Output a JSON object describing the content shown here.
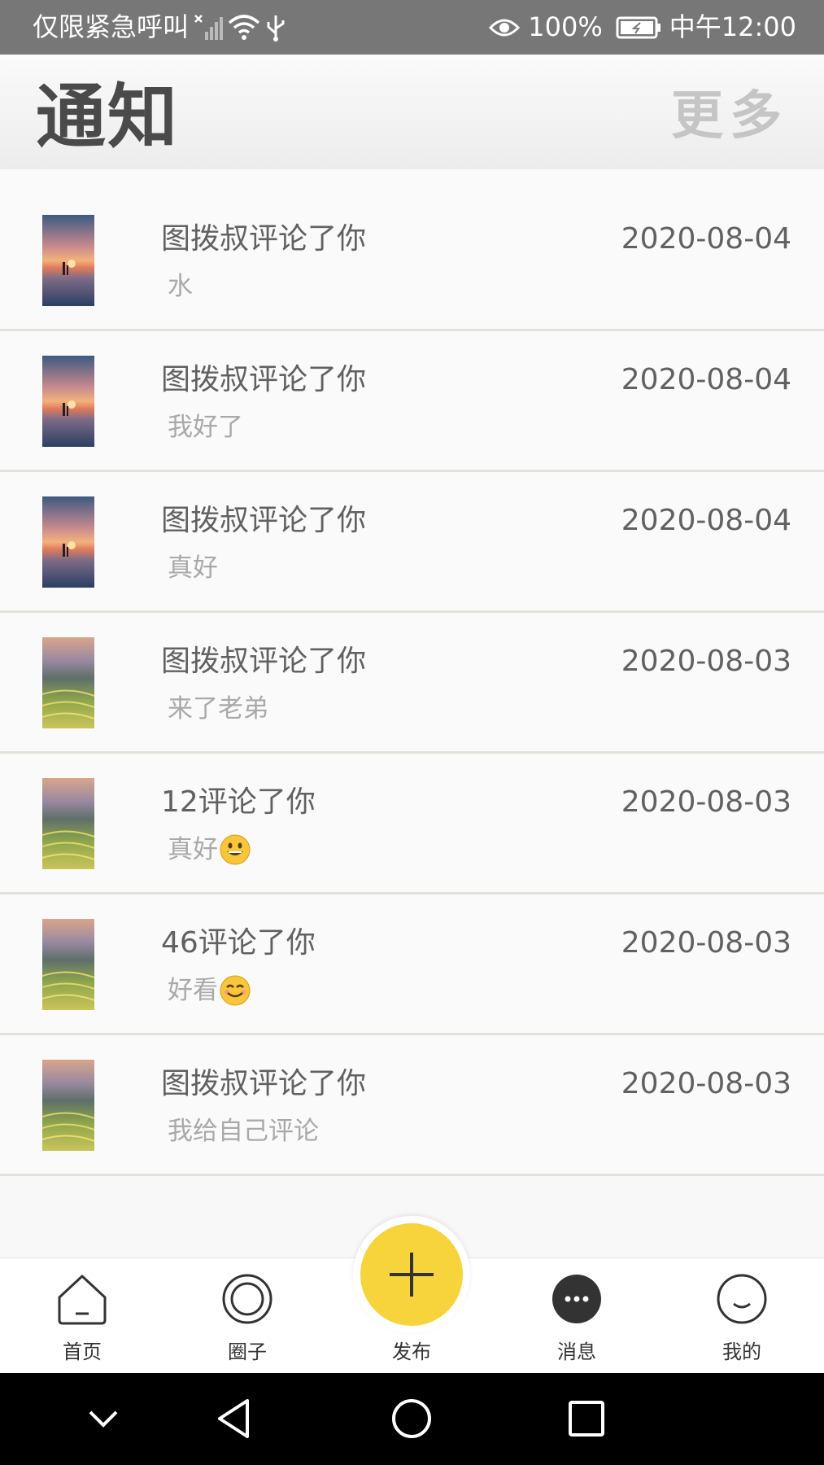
{
  "status_bar": {
    "carrier_text": "仅限紧急呼叫",
    "battery": "100%",
    "time": "中午12:00",
    "icons": [
      "no-sim-icon",
      "wifi-icon",
      "usb-icon",
      "eye-icon",
      "battery-icon"
    ]
  },
  "header": {
    "title": "通知",
    "more_label": "更多"
  },
  "notifications": [
    {
      "title": "图拨叔评论了你",
      "body": "水",
      "date": "2020-08-04",
      "thumb": "beach-sunset-image"
    },
    {
      "title": "图拨叔评论了你",
      "body": "我好了",
      "date": "2020-08-04",
      "thumb": "beach-sunset-image"
    },
    {
      "title": "图拨叔评论了你",
      "body": "真好",
      "date": "2020-08-04",
      "thumb": "beach-sunset-image"
    },
    {
      "title": "图拨叔评论了你",
      "body": "来了老弟",
      "date": "2020-08-03",
      "thumb": "terrace-landscape-image"
    },
    {
      "title": "12评论了你",
      "body": "真好",
      "emoji": "grinning-emoji",
      "date": "2020-08-03",
      "thumb": "terrace-landscape-image"
    },
    {
      "title": "46评论了你",
      "body": "好看",
      "emoji": "smiling-emoji",
      "date": "2020-08-03",
      "thumb": "terrace-landscape-image"
    },
    {
      "title": "图拨叔评论了你",
      "body": "我给自己评论",
      "date": "2020-08-03",
      "thumb": "terrace-landscape-image"
    }
  ],
  "bottom_nav": {
    "items": [
      {
        "label": "首页",
        "icon": "home-icon"
      },
      {
        "label": "圈子",
        "icon": "circle-icon"
      },
      {
        "label": "发布",
        "icon": "plus-icon"
      },
      {
        "label": "消息",
        "icon": "message-icon"
      },
      {
        "label": "我的",
        "icon": "profile-icon"
      }
    ]
  },
  "colors": {
    "accent": "#f7d43c",
    "status_bar": "#777777",
    "text_primary": "#616161",
    "text_secondary": "#a9a9a9"
  }
}
